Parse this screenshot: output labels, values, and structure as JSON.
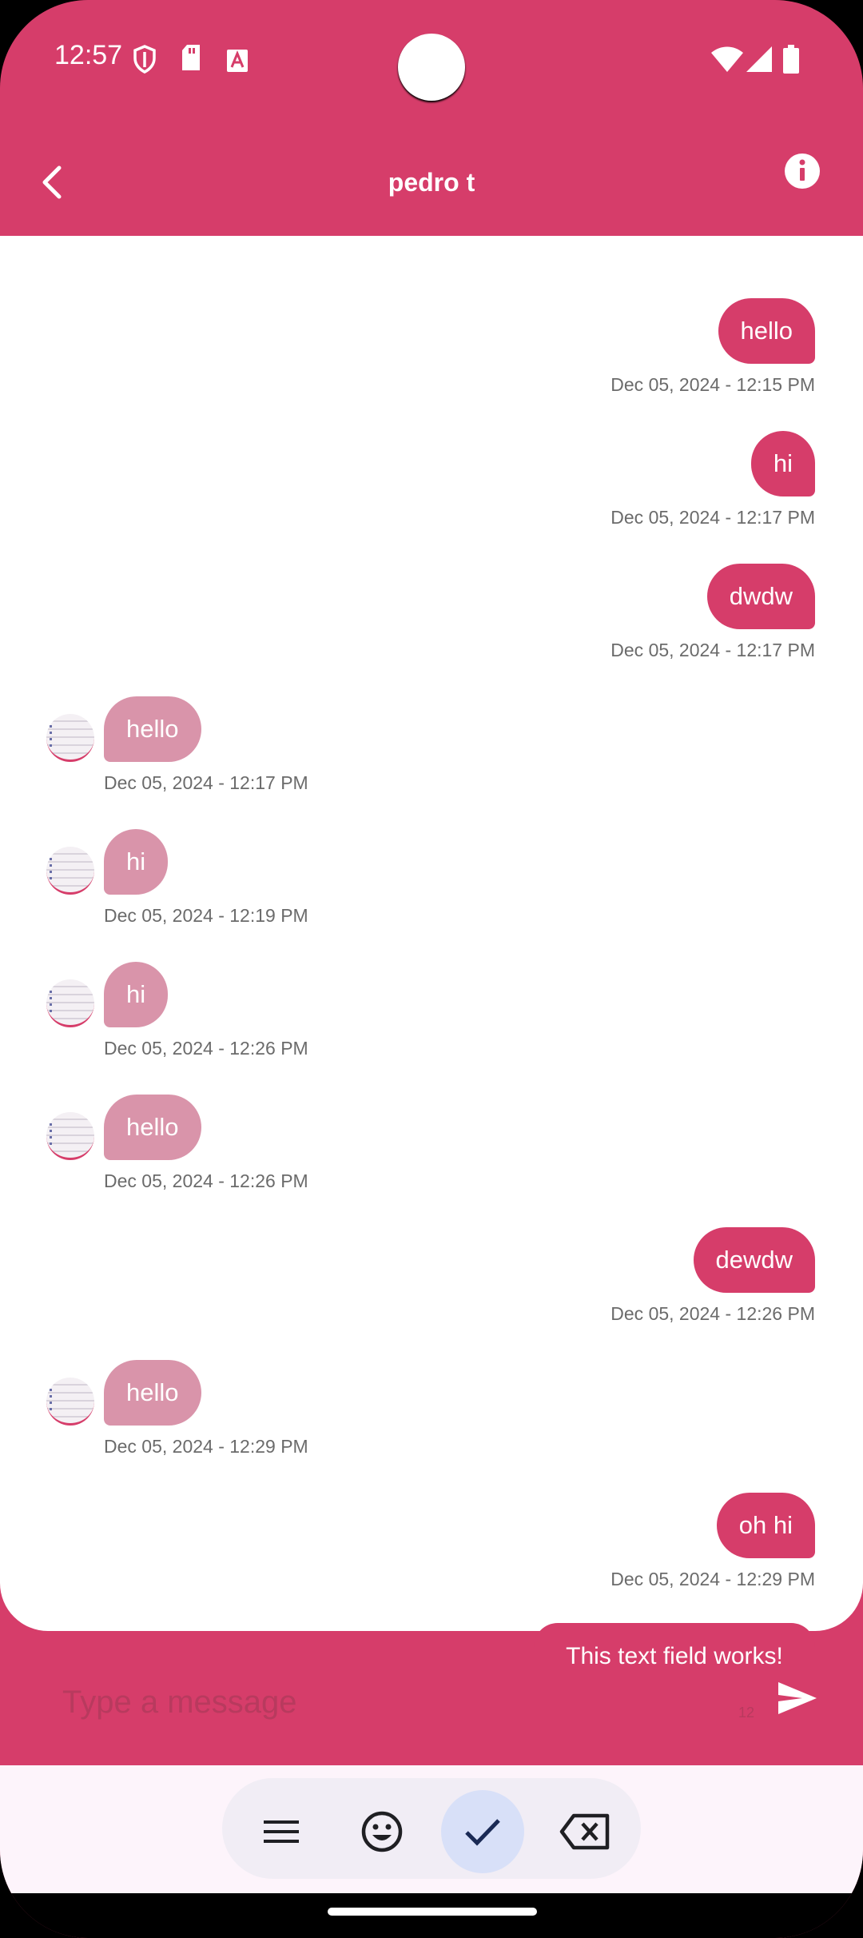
{
  "status_bar": {
    "time": "12:57",
    "left_icons": [
      "shield-icon",
      "sd-card-icon",
      "font-icon"
    ],
    "right_icons": [
      "wifi-icon",
      "signal-icon",
      "battery-icon"
    ]
  },
  "header": {
    "title": "pedro t",
    "back_icon": "back-icon",
    "info_icon": "info-icon"
  },
  "messages": [
    {
      "dir": "out",
      "text": "hello",
      "time": "Dec 05, 2024 - 12:15 PM"
    },
    {
      "dir": "out",
      "text": "hi",
      "time": "Dec 05, 2024 - 12:17 PM"
    },
    {
      "dir": "out",
      "text": "dwdw",
      "time": "Dec 05, 2024 - 12:17 PM"
    },
    {
      "dir": "in",
      "text": "hello",
      "time": "Dec 05, 2024 - 12:17 PM"
    },
    {
      "dir": "in",
      "text": "hi",
      "time": "Dec 05, 2024 - 12:19 PM"
    },
    {
      "dir": "in",
      "text": "hi",
      "time": "Dec 05, 2024 - 12:26 PM"
    },
    {
      "dir": "in",
      "text": "hello",
      "time": "Dec 05, 2024 - 12:26 PM"
    },
    {
      "dir": "out",
      "text": "dewdw",
      "time": "Dec 05, 2024 - 12:26 PM"
    },
    {
      "dir": "in",
      "text": "hello",
      "time": "Dec 05, 2024 - 12:29 PM"
    },
    {
      "dir": "out",
      "text": "oh hi",
      "time": "Dec 05, 2024 - 12:29 PM"
    }
  ],
  "peek_message": "This text field works!",
  "composer": {
    "placeholder": "Type a message",
    "counter": "12",
    "send_icon": "send-icon"
  },
  "keyboard_toolbar": {
    "buttons": [
      "menu-icon",
      "emoji-icon",
      "check-icon",
      "backspace-icon"
    ],
    "active": "check-icon"
  },
  "colors": {
    "accent": "#d63d6a",
    "incoming_bubble": "#d994aa",
    "timestamp": "#6b6b6b"
  }
}
